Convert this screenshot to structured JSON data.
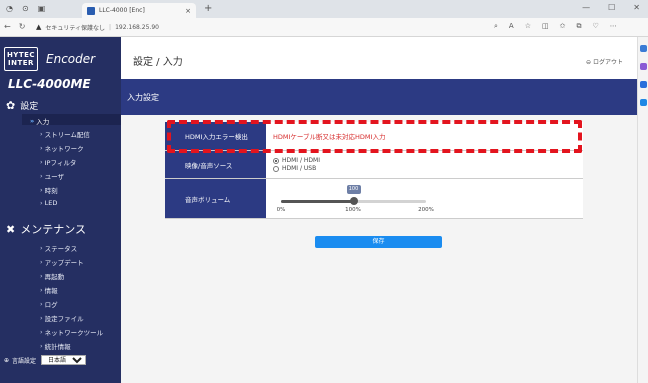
{
  "browser": {
    "tab_title": "LLC-4000 [Enc]",
    "url_warning": "セキュリティ保護なし",
    "url": "192.168.25.90",
    "tab_close": "×",
    "new_tab": "+"
  },
  "sidebar": {
    "logo_text_1": "HYTEC",
    "logo_text_2": "INTER",
    "product": "Encoder",
    "model": "LLC-4000ME",
    "settings_label": "設定",
    "settings_items": [
      "入力",
      "ストリーム配信",
      "ネットワーク",
      "IPフィルタ",
      "ユーザ",
      "時刻",
      "LED"
    ],
    "maintenance_label": "メンテナンス",
    "maintenance_items": [
      "ステータス",
      "アップデート",
      "再起動",
      "情報",
      "ログ",
      "設定ファイル",
      "ネットワークツール",
      "統計情報"
    ],
    "language_label": "言語設定",
    "language_value": "日本語"
  },
  "header": {
    "page_title": "設定 / 入力",
    "logout": "ログアウト"
  },
  "panel": {
    "title": "入力設定"
  },
  "form": {
    "hdmi_error_label": "HDMI入力エラー検出",
    "hdmi_error_value": "HDMIケーブル断又は未対応HDMI入力",
    "source_label": "映像/音声ソース",
    "source_options": [
      "HDMI / HDMI",
      "HDMI / USB"
    ],
    "source_selected_index": 0,
    "volume_label": "音声ボリューム",
    "volume_value": 100,
    "volume_value_text": "100",
    "volume_min": 0,
    "volume_max": 200,
    "volume_ticks": [
      "0%",
      "100%",
      "200%"
    ],
    "save_label": "保存"
  },
  "colors": {
    "sidebar_bg": "#252f62",
    "panel_header": "#2c3a83",
    "save_button": "#1a8cf0",
    "error_text": "#d62b2b",
    "highlight": "#e3141e"
  }
}
